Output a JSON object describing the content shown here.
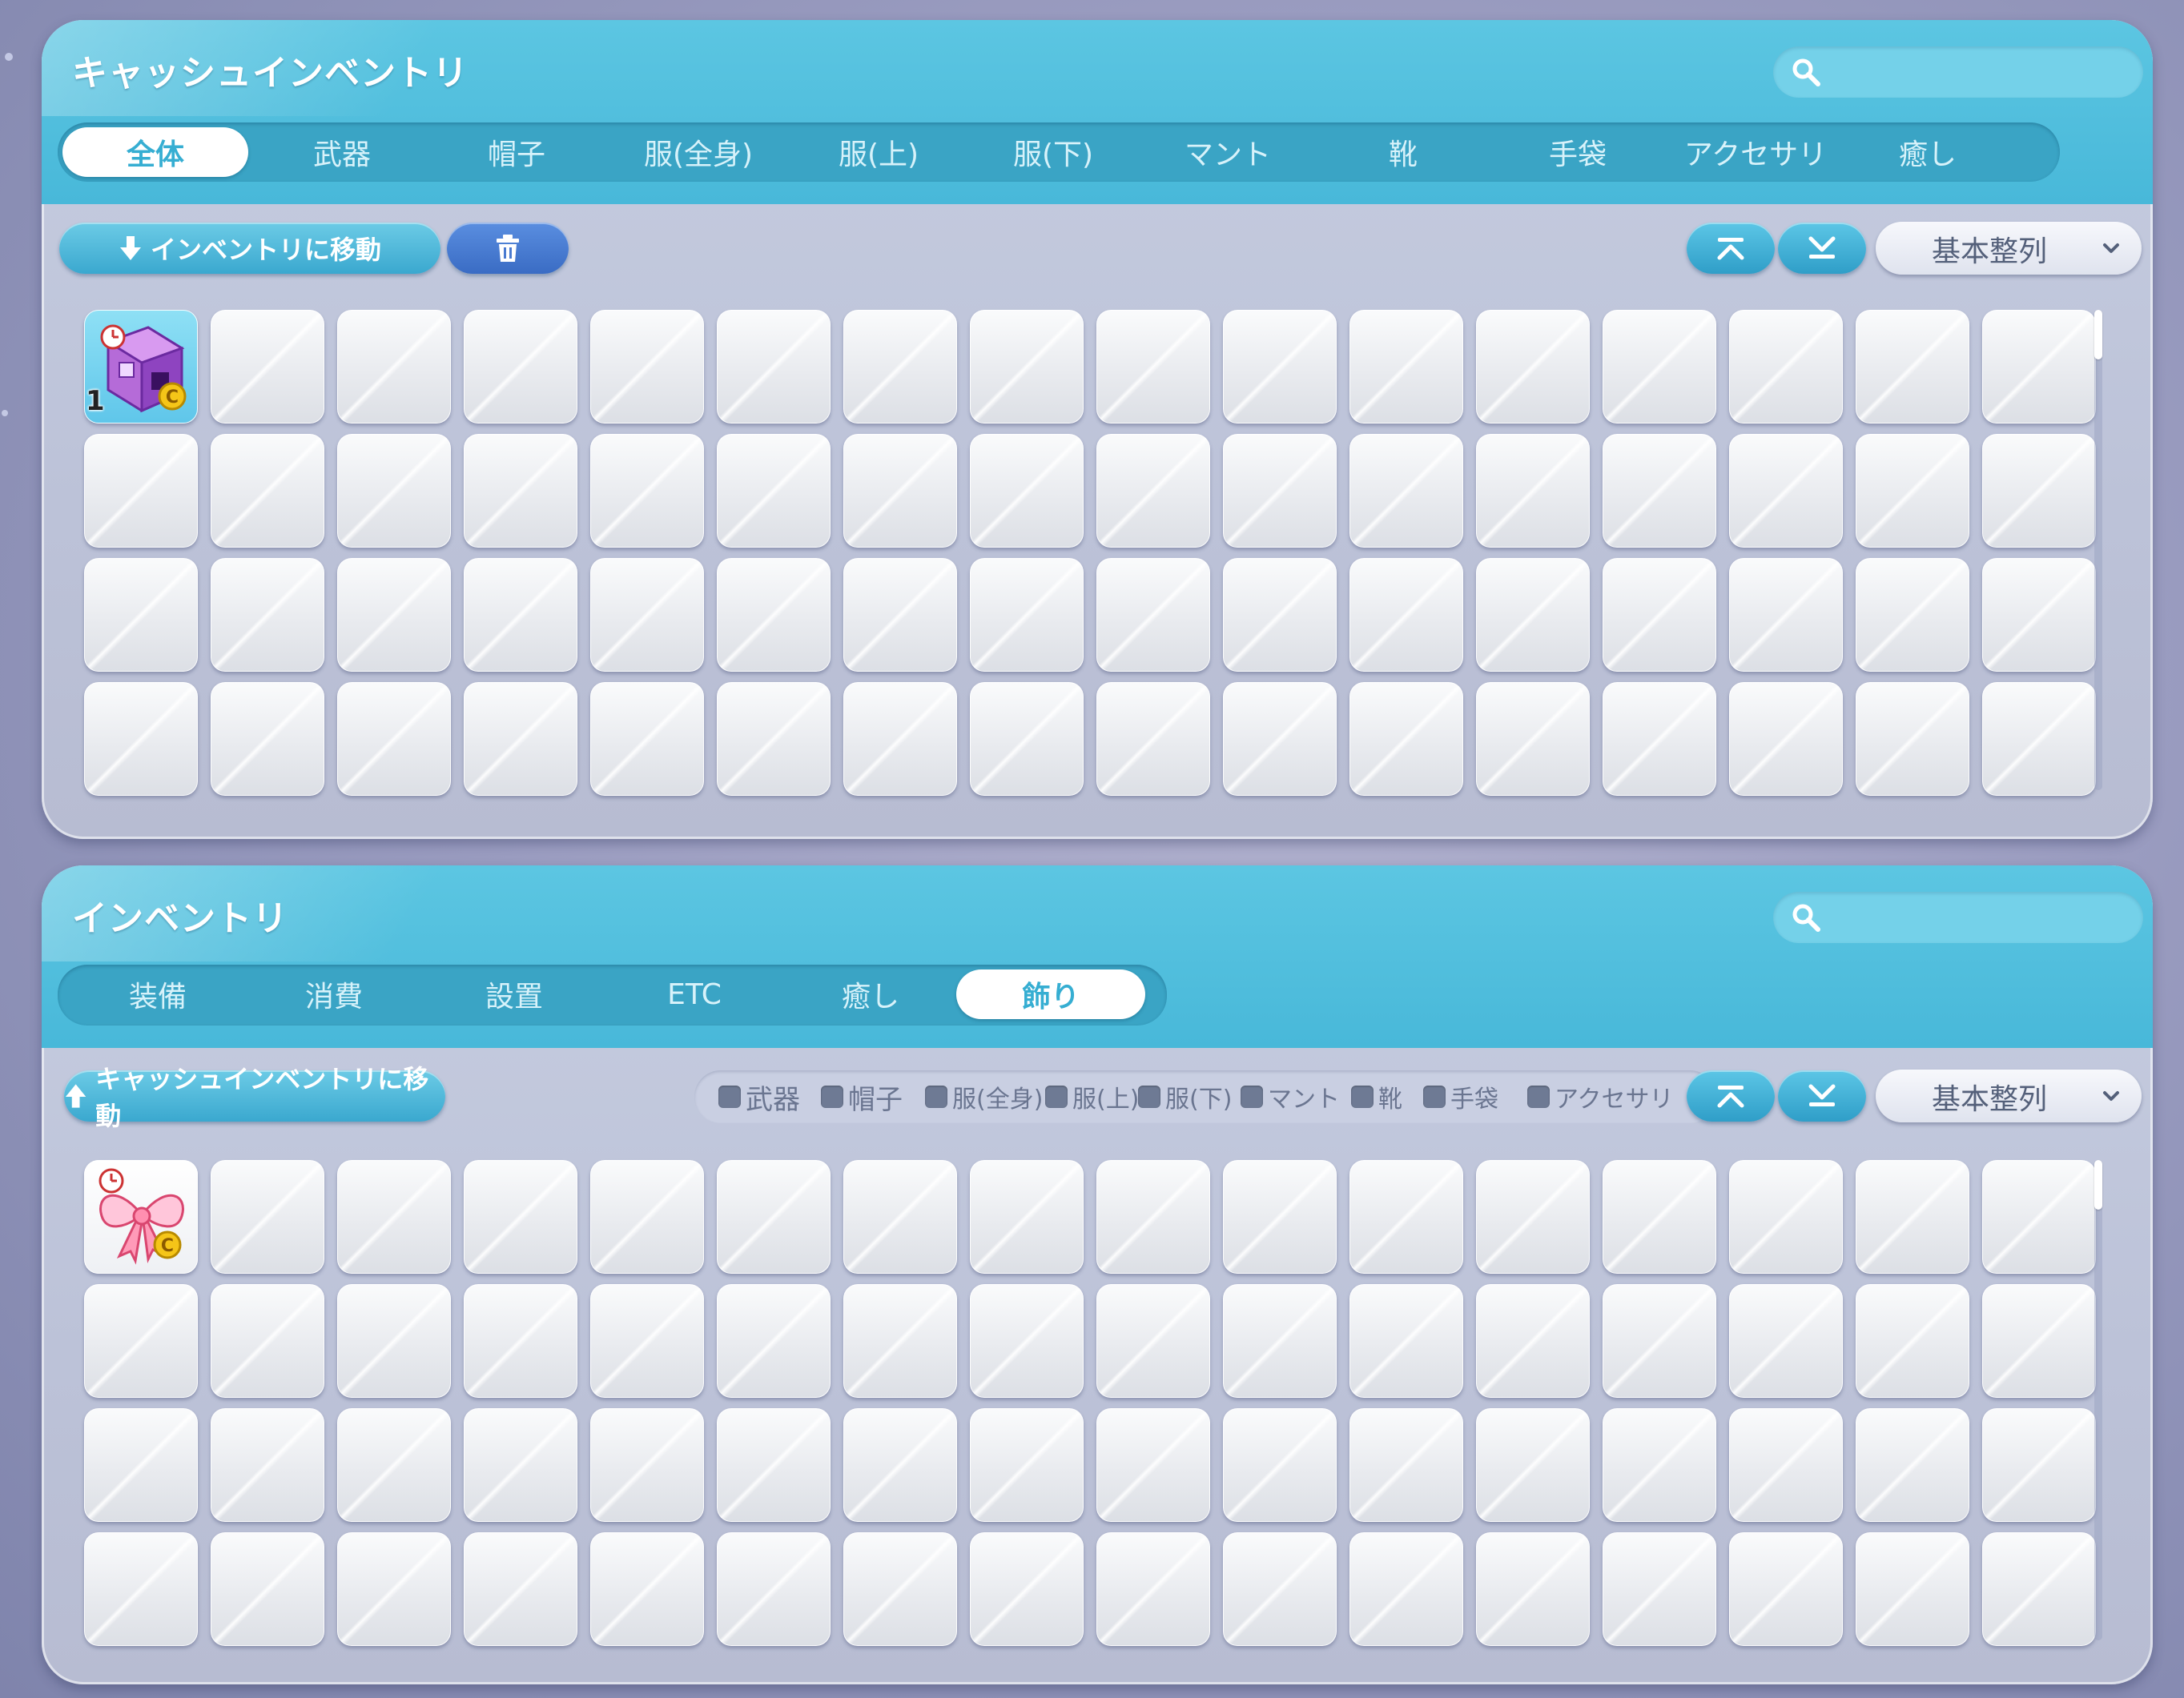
{
  "cash_inventory": {
    "title": "キャッシュインベントリ",
    "search": {
      "value": "",
      "placeholder": ""
    },
    "tabs": [
      {
        "label": "全体",
        "active": true
      },
      {
        "label": "武器",
        "active": false
      },
      {
        "label": "帽子",
        "active": false
      },
      {
        "label": "服(全身)",
        "active": false
      },
      {
        "label": "服(上)",
        "active": false
      },
      {
        "label": "服(下)",
        "active": false
      },
      {
        "label": "マント",
        "active": false
      },
      {
        "label": "靴",
        "active": false
      },
      {
        "label": "手袋",
        "active": false
      },
      {
        "label": "アクセサリ",
        "active": false
      },
      {
        "label": "癒し",
        "active": false
      }
    ],
    "move_button_label": "インベントリに移動",
    "move_button_icon": "arrow-down-icon",
    "trash_icon": "trash-icon",
    "sort_up_icon": "sort-up-icon",
    "sort_down_icon": "sort-down-icon",
    "sort_option": "基本整列",
    "grid": {
      "columns": 16,
      "rows": 4
    },
    "items": [
      {
        "slot": 0,
        "icon": "purple-cube-cash-item-icon",
        "count": "1"
      }
    ]
  },
  "inventory": {
    "title": "インベントリ",
    "search": {
      "value": "",
      "placeholder": ""
    },
    "tabs": [
      {
        "label": "装備",
        "active": false
      },
      {
        "label": "消費",
        "active": false
      },
      {
        "label": "設置",
        "active": false
      },
      {
        "label": "ETC",
        "active": false
      },
      {
        "label": "癒し",
        "active": false
      },
      {
        "label": "飾り",
        "active": true
      }
    ],
    "move_button_label": "キャッシュインベントリに移動",
    "move_button_icon": "arrow-up-icon",
    "filters": [
      {
        "label": "武器",
        "checked": false
      },
      {
        "label": "帽子",
        "checked": false
      },
      {
        "label": "服(全身)",
        "checked": false
      },
      {
        "label": "服(上)",
        "checked": false
      },
      {
        "label": "服(下)",
        "checked": false
      },
      {
        "label": "マント",
        "checked": false
      },
      {
        "label": "靴",
        "checked": false
      },
      {
        "label": "手袋",
        "checked": false
      },
      {
        "label": "アクセサリ",
        "checked": false
      }
    ],
    "sort_option": "基本整列",
    "grid": {
      "columns": 16,
      "rows": 4
    },
    "items": [
      {
        "slot": 0,
        "icon": "pink-ribbon-bow-item-icon",
        "count": ""
      }
    ]
  },
  "colors": {
    "header_cyan": "#48b8d9",
    "tab_active_text": "#36aed2",
    "panel_bg": "#bcc2d8",
    "slot_bg": "#eceef2"
  }
}
